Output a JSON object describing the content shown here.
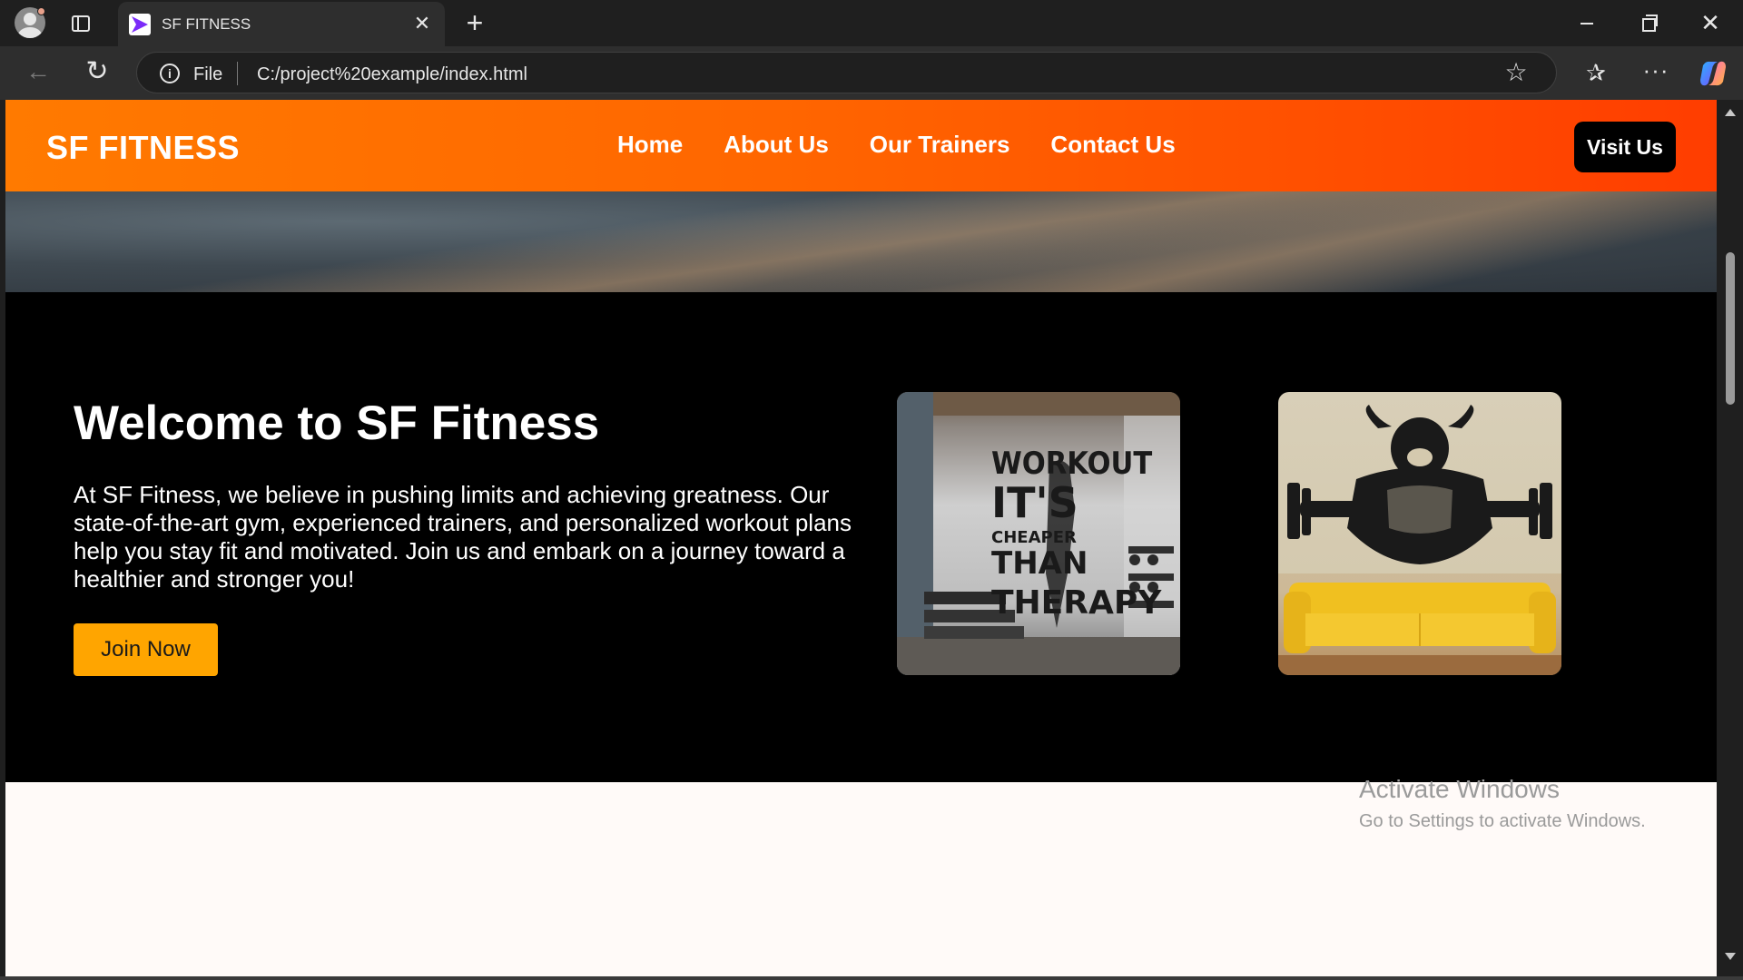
{
  "browser": {
    "tab_title": "SF FITNESS",
    "tab_close": "✕",
    "new_tab": "+",
    "address_scheme": "File",
    "address_url": "C:/project%20example/index.html",
    "icons": [
      "profile-icon",
      "tab-actions-icon",
      "favicon-icon",
      "back-icon",
      "reload-icon",
      "info-icon",
      "star-icon",
      "favorites-icon",
      "more-icon",
      "copilot-icon"
    ]
  },
  "site": {
    "brand": "SF FITNESS",
    "nav": [
      "Home",
      "About Us",
      "Our Trainers",
      "Contact Us"
    ],
    "visit_button": "Visit Us"
  },
  "welcome": {
    "title": "Welcome to SF Fitness",
    "text": "At SF Fitness, we believe in pushing limits and achieving greatness. Our state-of-the-art gym, experienced trainers, and personalized workout plans help you stay fit and motivated. Join us and embark on a journey toward a healthier and stronger you!",
    "join_button": "Join Now",
    "photo_1_lines": [
      "WORKOUT",
      "IT'S",
      "CHEAPER",
      "THAN",
      "THERAPY"
    ]
  },
  "watermark": {
    "title": "Activate Windows",
    "subtitle": "Go to Settings to activate Windows."
  },
  "colors": {
    "header_start": "#ff7a00",
    "header_end": "#ff3d00",
    "join_button": "#ffa500",
    "welcome_bg": "#000000"
  }
}
